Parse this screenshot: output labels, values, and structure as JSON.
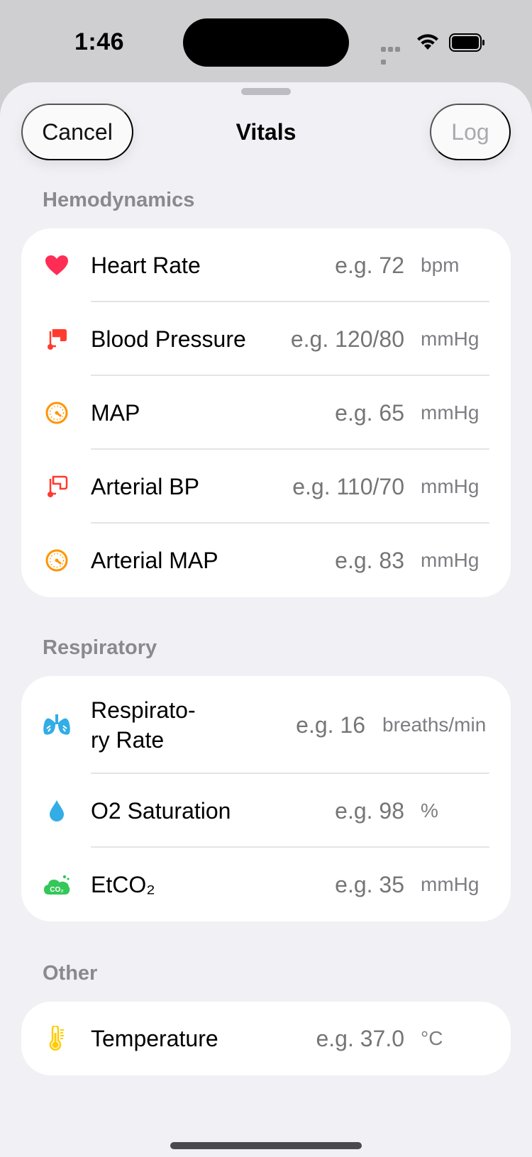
{
  "status_bar": {
    "time": "1:46"
  },
  "nav": {
    "cancel_label": "Cancel",
    "title": "Vitals",
    "log_label": "Log"
  },
  "sections": {
    "hemodynamics": {
      "title": "Hemodynamics",
      "rows": [
        {
          "label": "Heart Rate",
          "placeholder": "e.g. 72",
          "unit": "bpm",
          "icon": "heart-icon"
        },
        {
          "label": "Blood Pressure",
          "placeholder": "e.g. 120/80",
          "unit": "mmHg",
          "icon": "blood-pressure-cuff-icon"
        },
        {
          "label": "MAP",
          "placeholder": "e.g. 65",
          "unit": "mmHg",
          "icon": "gauge-icon"
        },
        {
          "label": "Arterial BP",
          "placeholder": "e.g. 110/70",
          "unit": "mmHg",
          "icon": "blood-pressure-cuff-outline-icon"
        },
        {
          "label": "Arterial MAP",
          "placeholder": "e.g. 83",
          "unit": "mmHg",
          "icon": "gauge-icon"
        }
      ]
    },
    "respiratory": {
      "title": "Respiratory",
      "rows": [
        {
          "label_line1": "Respirato-",
          "label_line2": "ry Rate",
          "placeholder": "e.g. 16",
          "unit": "breaths/min",
          "icon": "lungs-icon"
        },
        {
          "label": "O2 Saturation",
          "placeholder": "e.g. 98",
          "unit": "%",
          "icon": "drop-icon"
        },
        {
          "label": "EtCO₂",
          "placeholder": "e.g. 35",
          "unit": "mmHg",
          "icon": "co2-cloud-icon",
          "icon_text": "CO₂"
        }
      ]
    },
    "other": {
      "title": "Other",
      "rows": [
        {
          "label": "Temperature",
          "placeholder": "e.g. 37.0",
          "unit": "°C",
          "icon": "thermometer-icon"
        }
      ]
    }
  },
  "colors": {
    "heart": "#ff2d55",
    "blood_pressure": "#ff3b30",
    "gauge": "#ff9500",
    "lungs": "#32ade6",
    "drop": "#32ade6",
    "co2": "#34c759",
    "thermometer": "#ffcc00"
  }
}
